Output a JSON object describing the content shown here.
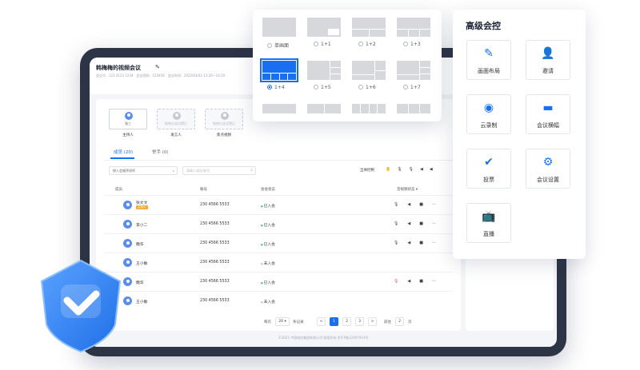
{
  "meeting": {
    "title": "韩梅梅的视频会议",
    "meta": "会议号：123 4123 1234　会议密码：123456　会议时间：2022/03/02 13:20—14:20"
  },
  "roles": [
    {
      "inner": "张三",
      "label": "主持人"
    },
    {
      "inner": "拖拽点选设置后",
      "label": "发言人"
    },
    {
      "inner": "拖拽点选设置后",
      "label": "焦点视频"
    }
  ],
  "tabs": {
    "members": "成员 (20)",
    "hands": "举手 (0)"
  },
  "filters": {
    "sort_label": "按入会顺序排序",
    "search_placeholder": "请输入成员/账号",
    "global_control": "全体控制"
  },
  "table": {
    "headers": {
      "member": "成员",
      "account": "账号",
      "status": "会会状态",
      "av_status": "音视频状态 ▾"
    },
    "rows": [
      {
        "name": "张文文",
        "badge": "主持人",
        "account": "230 4566 5533",
        "status": "已入会",
        "joined": true,
        "muted": false
      },
      {
        "name": "李小二",
        "badge": "",
        "account": "230 4566 5533",
        "status": "已入会",
        "joined": true,
        "muted": false
      },
      {
        "name": "魏华",
        "badge": "",
        "account": "230 4566 5533",
        "status": "已入会",
        "joined": true,
        "muted": false
      },
      {
        "name": "王小敏",
        "badge": "",
        "account": "230 4566 5533",
        "status": "未入会",
        "joined": false,
        "muted": false
      },
      {
        "name": "魏华",
        "badge": "",
        "account": "230 4566 5533",
        "status": "已入会",
        "joined": true,
        "muted": true
      },
      {
        "name": "王小敏",
        "badge": "",
        "account": "230 4566 5533",
        "status": "未入会",
        "joined": false,
        "muted": false
      }
    ]
  },
  "pager": {
    "per_page_prefix": "每页",
    "per_page_value": "20 ▾",
    "per_page_suffix": "条记录",
    "prev": "<",
    "pages": [
      "1",
      "2",
      "3"
    ],
    "next": ">",
    "jump_label": "前往",
    "jump_value": "2",
    "jump_suffix": "页"
  },
  "footer": "©2021 中国电信集团有限公司 版权所有 京ICP备12007914号",
  "layouts": [
    {
      "label": "单画面",
      "selected": false
    },
    {
      "label": "1+1",
      "selected": false
    },
    {
      "label": "1+2",
      "selected": false
    },
    {
      "label": "1+3",
      "selected": false
    },
    {
      "label": "1+4",
      "selected": true
    },
    {
      "label": "1+5",
      "selected": false
    },
    {
      "label": "1+6",
      "selected": false
    },
    {
      "label": "1+7",
      "selected": false
    }
  ],
  "advanced": {
    "title": "高级会控",
    "buttons": [
      {
        "label": "画面布局",
        "icon": "layout-edit-icon"
      },
      {
        "label": "邀请",
        "icon": "invite-user-icon"
      },
      {
        "label": "云录制",
        "icon": "cloud-record-icon"
      },
      {
        "label": "会议横幅",
        "icon": "banner-icon"
      },
      {
        "label": "投票",
        "icon": "vote-icon"
      },
      {
        "label": "会议设置",
        "icon": "gear-icon"
      },
      {
        "label": "直播",
        "icon": "live-tv-icon"
      }
    ]
  },
  "colors": {
    "accent": "#1a6ff0",
    "frame": "#2c3446",
    "shield": "#3a86f5"
  }
}
